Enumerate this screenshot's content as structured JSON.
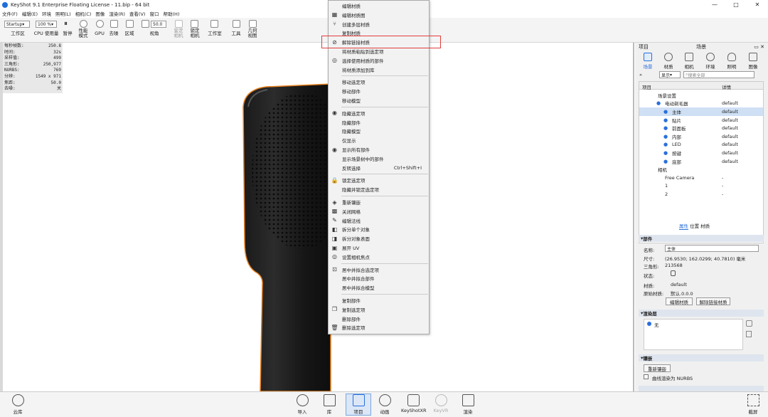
{
  "window": {
    "title": "KeyShot 9.1 Enterprise Floating License  - 11.bip  - 64 bit",
    "min": "—",
    "max": "□",
    "close": "✕"
  },
  "menu": [
    "文件(F)",
    "编辑(E)",
    "环境",
    "照明(L)",
    "相机(C)",
    "图像",
    "渲染(R)",
    "查看(V)",
    "窗口",
    "帮助(H)"
  ],
  "toolbar": {
    "mode_select": "Startup",
    "zoom_select": "100 %",
    "fov_value": "50.0",
    "labels": [
      "工作区",
      "CPU 使用量",
      "暂停",
      "性能\n模式",
      "GPU",
      "去噪",
      "区域",
      "视角",
      "鉴定\n相机",
      "锁定\n相机",
      "工作室",
      "工具",
      "几何\n视图"
    ]
  },
  "stats": [
    {
      "k": "每秒帧数:",
      "v": "250.8"
    },
    {
      "k": "时间:",
      "v": "32s"
    },
    {
      "k": "采样值:",
      "v": "499"
    },
    {
      "k": "三角形:",
      "v": "250,977"
    },
    {
      "k": "NURBS:",
      "v": "769"
    },
    {
      "k": "分辨:",
      "v": "1549 x 971"
    },
    {
      "k": "焦距:",
      "v": "50.0"
    },
    {
      "k": "去噪:",
      "v": "关"
    }
  ],
  "context_menu": [
    {
      "label": "编辑材质",
      "icon": ""
    },
    {
      "label": "编辑材质图",
      "icon": "graph-icon"
    },
    {
      "label": "创建多层材质",
      "icon": "split-icon"
    },
    {
      "label": "复制材质",
      "icon": ""
    },
    {
      "label": "解除链接材质",
      "icon": "unlink-icon"
    },
    {
      "label": "将材质粘贴到选定项",
      "icon": ""
    },
    {
      "label": "选择使用材质的部件",
      "icon": "select-icon"
    },
    {
      "label": "将材质添加到库",
      "icon": ""
    },
    {
      "sep": true
    },
    {
      "label": "移动选定项",
      "icon": ""
    },
    {
      "label": "移动部件",
      "icon": ""
    },
    {
      "label": "移动模型",
      "icon": ""
    },
    {
      "sep": true
    },
    {
      "label": "隐藏选定项",
      "icon": "eye-icon"
    },
    {
      "label": "隐藏部件",
      "icon": ""
    },
    {
      "label": "隐藏模型",
      "icon": ""
    },
    {
      "label": "仅显示",
      "icon": ""
    },
    {
      "label": "显示所有部件",
      "icon": "eye-icon"
    },
    {
      "label": "显示场景树中的部件",
      "icon": ""
    },
    {
      "label": "反转选择",
      "icon": "",
      "shortcut": "Ctrl+Shift+I"
    },
    {
      "sep": true
    },
    {
      "label": "锁定选定项",
      "icon": "lock-icon"
    },
    {
      "label": "隐藏并锁定选定项",
      "icon": ""
    },
    {
      "sep": true
    },
    {
      "label": "重新镶嵌",
      "icon": "mesh-icon"
    },
    {
      "label": "关闭网格",
      "icon": "grid-icon"
    },
    {
      "label": "编辑法线",
      "icon": "normal-icon"
    },
    {
      "label": "拆分单个对象",
      "icon": "split-object-icon"
    },
    {
      "label": "拆分对象表面",
      "icon": "surface-icon"
    },
    {
      "label": "展开 UV",
      "icon": "uv-icon"
    },
    {
      "label": "设置相机焦点",
      "icon": "focus-icon"
    },
    {
      "sep": true
    },
    {
      "label": "居中并拟合选定项",
      "icon": "fit-icon"
    },
    {
      "label": "居中并拟合部件",
      "icon": ""
    },
    {
      "label": "居中并拟合模型",
      "icon": ""
    },
    {
      "sep": true
    },
    {
      "label": "复制部件",
      "icon": ""
    },
    {
      "label": "复制选定项",
      "icon": "copy-icon"
    },
    {
      "label": "删除部件",
      "icon": ""
    },
    {
      "label": "删除选定项",
      "icon": "trash-icon"
    }
  ],
  "right_panel": {
    "header": {
      "left": "项目",
      "center": "场景"
    },
    "tabs": [
      "场景",
      "材质",
      "相机",
      "环境",
      "照明",
      "图像"
    ],
    "display_select": "显示",
    "search_placeholder": "搜索全部",
    "tree_cols": [
      "项目",
      "详情"
    ],
    "tree": [
      {
        "name": "场景设置",
        "detail": "",
        "indent": 1
      },
      {
        "name": "电动剃毛器",
        "detail": "default",
        "indent": 2
      },
      {
        "name": "主体",
        "detail": "default",
        "indent": 3,
        "selected": true
      },
      {
        "name": "贴片",
        "detail": "default",
        "indent": 3
      },
      {
        "name": "前面板",
        "detail": "default",
        "indent": 3
      },
      {
        "name": "内部",
        "detail": "default",
        "indent": 3
      },
      {
        "name": "LED",
        "detail": "default",
        "indent": 3
      },
      {
        "name": "按键",
        "detail": "default",
        "indent": 3
      },
      {
        "name": "底部",
        "detail": "default",
        "indent": 3
      },
      {
        "name": "相机",
        "detail": "",
        "indent": 1
      },
      {
        "name": "Free Camera",
        "detail": "-",
        "indent": 2
      },
      {
        "name": "1",
        "detail": "-",
        "indent": 2
      },
      {
        "name": "2",
        "detail": "-",
        "indent": 2
      }
    ],
    "subtabs": [
      "属性",
      "位置",
      "材质"
    ],
    "part": {
      "section": "部件",
      "name_label": "名称:",
      "name_value": "主体",
      "size_label": "尺寸:",
      "size_value": "(26.9530; 162.0299; 40.7810) 毫米",
      "tri_label": "三角形:",
      "tri_value": "213568",
      "state_label": "状态:",
      "material_label": "材质:",
      "material_value": "default",
      "root_label": "原始材质:",
      "root_value": "默认.0.0.0",
      "btn_edit": "编辑材质",
      "btn_unlink": "解除链接材质"
    },
    "render_layer": {
      "section": "渲染层",
      "item": "无"
    },
    "tess": {
      "section": "镶嵌",
      "btn": "重新镶嵌",
      "checkbox": "曲线渲染为 NURBS"
    }
  },
  "bottom": {
    "cloud": "云库",
    "items": [
      "导入",
      "库",
      "项目",
      "动画",
      "KeyShotXR",
      "KeyVR",
      "渲染"
    ],
    "active": "项目",
    "right": "截屏"
  },
  "colors": {
    "accent": "#2a6fdb",
    "highlight_box": "#e23c3c",
    "selection": "#cfe0f5",
    "outline": "#e8821e"
  }
}
